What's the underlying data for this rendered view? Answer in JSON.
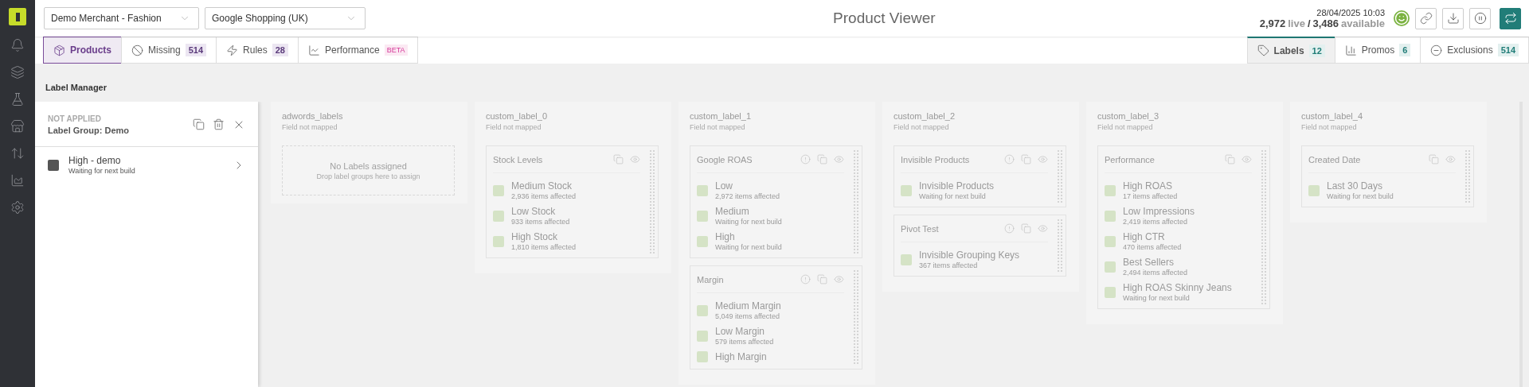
{
  "merchant_select": {
    "value": "Demo Merchant - Fashion"
  },
  "feed_select": {
    "value": "Google Shopping (UK)"
  },
  "title": "Product Viewer",
  "status": {
    "timestamp": "28/04/2025 10:03",
    "live": "2,972",
    "live_label": "live",
    "separator": "/",
    "available": "3,486",
    "available_label": "available"
  },
  "main_tabs": [
    {
      "label": "Products",
      "selected": true
    },
    {
      "label": "Missing",
      "count": "514",
      "selected": false
    },
    {
      "label": "Rules",
      "count": "28",
      "selected": false
    },
    {
      "label": "Performance",
      "tag": "BETA",
      "selected": false
    }
  ],
  "side_tabs": [
    {
      "label": "Labels",
      "count": "12",
      "selected": true
    },
    {
      "label": "Promos",
      "count": "6",
      "selected": false
    },
    {
      "label": "Exclusions",
      "count": "514",
      "selected": false
    }
  ],
  "section_title": "Label Manager",
  "panel": {
    "status": "NOT APPLIED",
    "title": "Label Group: Demo",
    "items": [
      {
        "name": "High - demo",
        "detail": "Waiting for next build"
      }
    ]
  },
  "columns": [
    {
      "name": "adwords_labels",
      "note": "Field not mapped",
      "empty_title": "No Labels assigned",
      "empty_hint": "Drop label groups here to assign"
    },
    {
      "name": "custom_label_0",
      "note": "Field not mapped",
      "groups": [
        {
          "name": "Stock Levels",
          "alert": false,
          "labels": [
            {
              "name": "Medium Stock",
              "detail": "2,936 items affected"
            },
            {
              "name": "Low Stock",
              "detail": "933 items affected"
            },
            {
              "name": "High Stock",
              "detail": "1,810 items affected"
            }
          ]
        }
      ]
    },
    {
      "name": "custom_label_1",
      "note": "Field not mapped",
      "groups": [
        {
          "name": "Google ROAS",
          "alert": true,
          "labels": [
            {
              "name": "Low",
              "detail": "2,972 items affected"
            },
            {
              "name": "Medium",
              "detail": "Waiting for next build"
            },
            {
              "name": "High",
              "detail": "Waiting for next build"
            }
          ]
        },
        {
          "name": "Margin",
          "alert": true,
          "labels": [
            {
              "name": "Medium Margin",
              "detail": "5,049 items affected"
            },
            {
              "name": "Low Margin",
              "detail": "579 items affected"
            },
            {
              "name": "High Margin"
            }
          ]
        }
      ]
    },
    {
      "name": "custom_label_2",
      "note": "Field not mapped",
      "groups": [
        {
          "name": "Invisible Products",
          "alert": true,
          "labels": [
            {
              "name": "Invisible Products",
              "detail": "Waiting for next build"
            }
          ]
        },
        {
          "name": "Pivot Test",
          "alert": true,
          "labels": [
            {
              "name": "Invisible Grouping Keys",
              "detail": "367 items affected"
            }
          ]
        }
      ]
    },
    {
      "name": "custom_label_3",
      "note": "Field not mapped",
      "groups": [
        {
          "name": "Performance",
          "alert": false,
          "labels": [
            {
              "name": "High ROAS",
              "detail": "17 items affected"
            },
            {
              "name": "Low Impressions",
              "detail": "2,419 items affected"
            },
            {
              "name": "High CTR",
              "detail": "470 items affected"
            },
            {
              "name": "Best Sellers",
              "detail": "2,494 items affected"
            },
            {
              "name": "High ROAS Skinny Jeans",
              "detail": "Waiting for next build"
            }
          ]
        }
      ]
    },
    {
      "name": "custom_label_4",
      "note": "Field not mapped",
      "groups": [
        {
          "name": "Created Date",
          "alert": false,
          "labels": [
            {
              "name": "Last 30 Days",
              "detail": "Waiting for next build"
            }
          ]
        }
      ]
    }
  ]
}
